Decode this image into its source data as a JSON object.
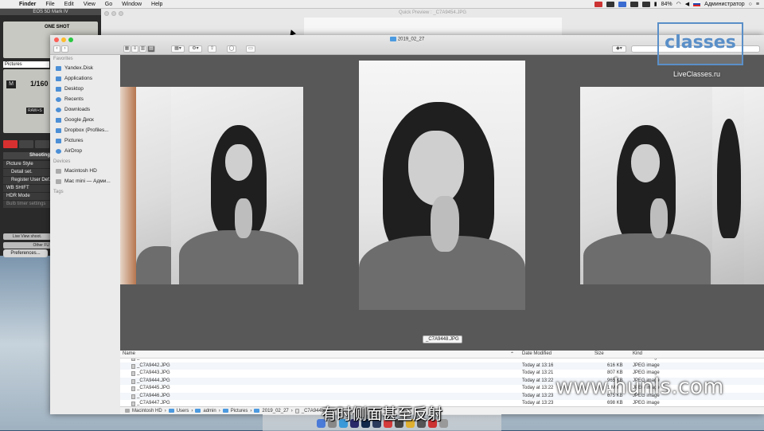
{
  "menubar": {
    "items": [
      "Finder",
      "File",
      "Edit",
      "View",
      "Go",
      "Window",
      "Help"
    ],
    "battery": "84%",
    "user": "Администратор"
  },
  "eos": {
    "title": "EOS 5D Mark IV",
    "focus_mode": "ONE SHOT",
    "picture_select": "Pictures",
    "mode": "M",
    "shutter": "1/160",
    "quality": "RAW+S",
    "section_label": "Shooting",
    "menu": [
      "Picture Style",
      "Detail set.",
      "Register User Def.",
      "WB SHIFT",
      "HDR Mode",
      "Bulb timer settings"
    ],
    "live_view_button": "Live View shoot.",
    "other_button": "Other FU",
    "preferences_button": "Preferences..."
  },
  "quick_preview": {
    "title": "Quick Preview : _C7A9454.JPG"
  },
  "finder": {
    "title": "2019_02_27",
    "sidebar": {
      "favorites_label": "Favorites",
      "favorites": [
        "Yandex.Disk",
        "Applications",
        "Desktop",
        "Recents",
        "Downloads",
        "Google Диск",
        "Dropbox (Profiles...",
        "Pictures",
        "AirDrop"
      ],
      "devices_label": "Devices",
      "devices": [
        "Macintosh HD",
        "Mac mini — Адми..."
      ],
      "tags_label": "Tags"
    },
    "cover_caption": "_C7A9448.JPG",
    "columns": {
      "name": "Name",
      "date": "Date Modified",
      "size": "Size",
      "kind": "Kind"
    },
    "rows": [
      {
        "name": "_C7A9441.JPG",
        "date": "",
        "size": "",
        "kind": "JPEG image"
      },
      {
        "name": "_C7A9442.JPG",
        "date": "Today at 13:16",
        "size": "616 KB",
        "kind": "JPEG image"
      },
      {
        "name": "_C7A9443.JPG",
        "date": "Today at 13:21",
        "size": "807 KB",
        "kind": "JPEG image"
      },
      {
        "name": "_C7A9444.JPG",
        "date": "Today at 13:22",
        "size": "965 KB",
        "kind": "JPEG image"
      },
      {
        "name": "_C7A9445.JPG",
        "date": "Today at 13:22",
        "size": "1 MB",
        "kind": "JPEG image"
      },
      {
        "name": "_C7A9446.JPG",
        "date": "Today at 13:23",
        "size": "675 KB",
        "kind": "JPEG image"
      },
      {
        "name": "_C7A9447.JPG",
        "date": "Today at 13:23",
        "size": "698 KB",
        "kind": "JPEG image"
      },
      {
        "name": "_C7A9448.JPG",
        "date": "Today at 13:23",
        "size": "768 KB",
        "kind": "JPEG image"
      },
      {
        "name": "_C7A9449.JPG",
        "date": "Today at 13:23",
        "size": "",
        "kind": "JPEG image"
      },
      {
        "name": "_C7A9450.JPG",
        "date": "Today at 13:23",
        "size": "",
        "kind": "JPEG image"
      }
    ],
    "selected_row": 7,
    "path": [
      "Macintosh HD",
      "Users",
      "admin",
      "Pictures",
      "2019_02_27",
      "_C7A9448.JPG"
    ]
  },
  "overlay": {
    "logo": "classes",
    "logo_site": "LiveClasses.ru",
    "watermark": "www.hunls.com",
    "subtitle": "有时侧面甚至反射"
  },
  "colors": {
    "selection": "#0a59c7",
    "logo": "#5a8fc8"
  }
}
